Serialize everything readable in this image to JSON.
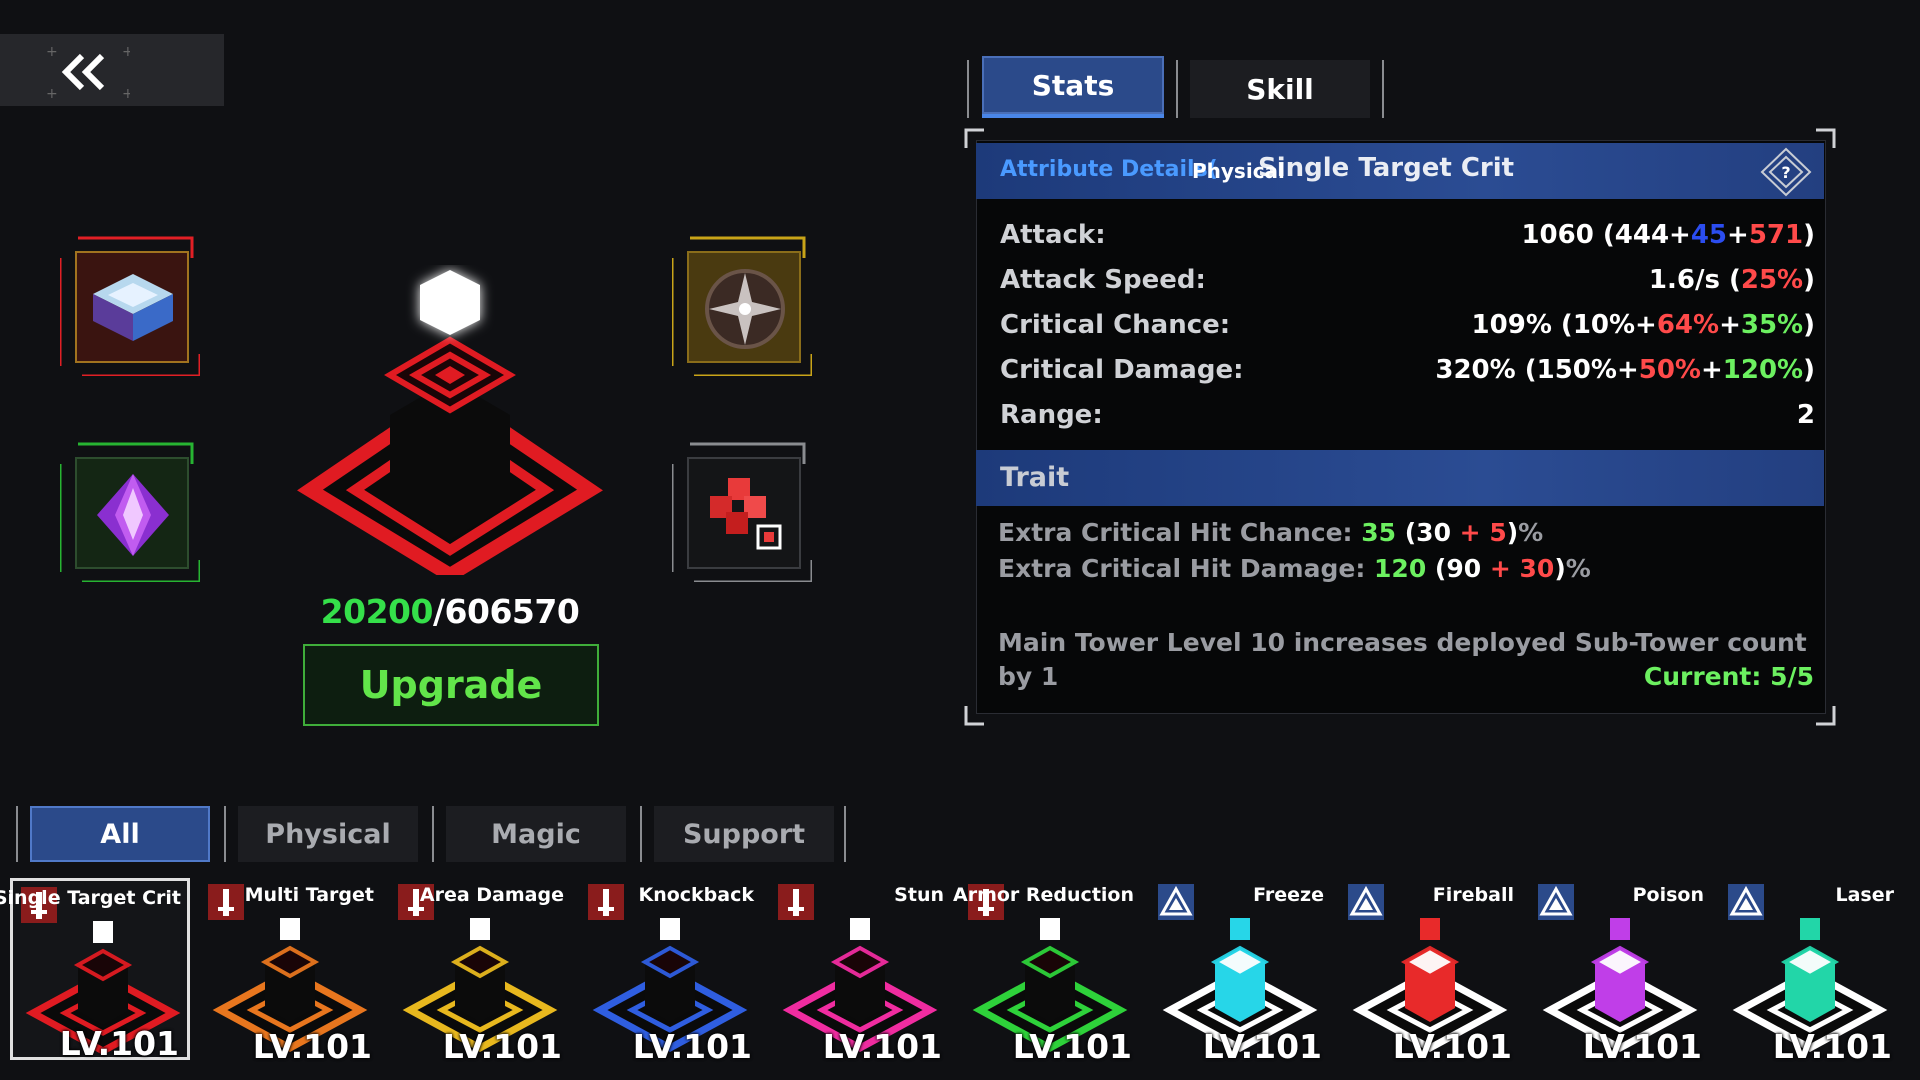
{
  "nav": {
    "back_icon": "double-chevron-left-icon"
  },
  "gear_slots": [
    {
      "name": "blue-crystal-box",
      "frame_color": "#e11f25"
    },
    {
      "name": "purple-gem",
      "frame_color": "#27b432"
    },
    {
      "name": "compass-star",
      "frame_color": "#c9a418"
    },
    {
      "name": "red-cube-cluster",
      "frame_color": "#8a8c90"
    }
  ],
  "tower": {
    "icon": "single-target-crit-tower-icon",
    "color": "#e01b22"
  },
  "experience": {
    "current": "20200",
    "separator": "/",
    "required": "606570"
  },
  "upgrade_label": "Upgrade",
  "top_tabs": [
    {
      "label": "Stats",
      "active": true
    },
    {
      "label": "Skill",
      "active": false
    }
  ],
  "panel": {
    "header_prefix": "Attribute Details(",
    "header_type": "Physical",
    "header_title": "Single Target Crit",
    "info_icon": "help-diamond-icon",
    "stats": [
      {
        "label": "Attack:",
        "total": "1060 (",
        "base": "444",
        "p1": "+",
        "bonus1": "45",
        "p2": "+",
        "bonus2": "571",
        "close": ")"
      },
      {
        "label": "Attack Speed:",
        "total": "1.6/s (",
        "bonus1": "25%",
        "close": ")"
      },
      {
        "label": "Critical Chance:",
        "total": "109% (",
        "base": "10%",
        "p1": "+",
        "bonus1": "64%",
        "p2": "+",
        "bonus2": "35%",
        "close": ")"
      },
      {
        "label": "Critical Damage:",
        "total": "320% (",
        "base": "150%",
        "p1": "+",
        "bonus1": "50%",
        "p2": "+",
        "bonus2": "120%",
        "close": ")"
      },
      {
        "label": "Range:",
        "total": "2"
      }
    ],
    "trait_header": "Trait",
    "traits": [
      {
        "label": "Extra Critical Hit Chance: ",
        "total": "35",
        "open": " (",
        "base": "30",
        "plus": " + ",
        "bonus": "5",
        "close": ")",
        "unit": "%"
      },
      {
        "label": "Extra Critical Hit Damage: ",
        "total": "120",
        "open": " (",
        "base": "90",
        "plus": " + ",
        "bonus": "30",
        "close": ")",
        "unit": "%"
      }
    ],
    "description_line1": "Main Tower Level 10 increases deployed Sub-Tower count",
    "description_line2": "by 1",
    "current_label": "Current: 5/5"
  },
  "filter_tabs": [
    {
      "label": "All",
      "active": true
    },
    {
      "label": "Physical",
      "active": false
    },
    {
      "label": "Magic",
      "active": false
    },
    {
      "label": "Support",
      "active": false
    }
  ],
  "towers": [
    {
      "name": "Single Target Crit",
      "level": "LV.101",
      "color": "#e01b22",
      "type": "physical",
      "selected": true
    },
    {
      "name": "Multi Target",
      "level": "LV.101",
      "color": "#e8761e",
      "type": "physical"
    },
    {
      "name": "Area Damage",
      "level": "LV.101",
      "color": "#e8b81e",
      "type": "physical"
    },
    {
      "name": "Knockback",
      "level": "LV.101",
      "color": "#2f5ee0",
      "type": "physical"
    },
    {
      "name": "Stun",
      "level": "LV.101",
      "color": "#f02ca0",
      "type": "physical"
    },
    {
      "name": "Armor Reduction",
      "level": "LV.101",
      "color": "#2ed23a",
      "type": "physical"
    },
    {
      "name": "Freeze",
      "level": "LV.101",
      "color": "#27d6e8",
      "type": "magic"
    },
    {
      "name": "Fireball",
      "level": "LV.101",
      "color": "#e82a2a",
      "type": "magic"
    },
    {
      "name": "Poison",
      "level": "LV.101",
      "color": "#c03ee8",
      "type": "magic"
    },
    {
      "name": "Laser",
      "level": "LV.101",
      "color": "#22d6a8",
      "type": "magic"
    }
  ]
}
